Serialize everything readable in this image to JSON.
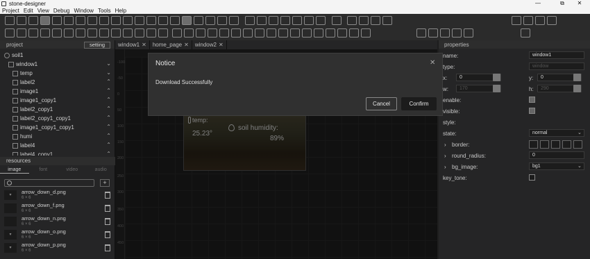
{
  "window": {
    "title": "stone-designer",
    "min": "—",
    "max": "⧉",
    "close": "✕"
  },
  "menu": [
    "Project",
    "Edit",
    "View",
    "Debug",
    "Window",
    "Tools",
    "Help"
  ],
  "left": {
    "project_label": "project",
    "setting_label": "setting",
    "tree": [
      {
        "label": "soil1"
      },
      {
        "label": "window1"
      },
      {
        "label": "temp"
      },
      {
        "label": "label2"
      },
      {
        "label": "image1"
      },
      {
        "label": "image1_copy1"
      },
      {
        "label": "label2_copy1"
      },
      {
        "label": "label2_copy1_copy1"
      },
      {
        "label": "image1_copy1_copy1"
      },
      {
        "label": "humi"
      },
      {
        "label": "label4"
      },
      {
        "label": "label4_copy1"
      }
    ],
    "resources_label": "resources",
    "res_tabs": [
      "image",
      "font",
      "video",
      "audio"
    ],
    "search_placeholder": "",
    "add_label": "+",
    "res_items": [
      {
        "name": "arrow_down_d.png",
        "dim": "6 × 6"
      },
      {
        "name": "arrow_down_f.png",
        "dim": "6 × 6"
      },
      {
        "name": "arrow_down_n.png",
        "dim": "6 × 6"
      },
      {
        "name": "arrow_down_o.png",
        "dim": "6 × 6"
      },
      {
        "name": "arrow_down_p.png",
        "dim": "6 × 6"
      }
    ]
  },
  "tabs": [
    {
      "label": "window1",
      "close": "✕"
    },
    {
      "label": "home_page",
      "close": "✕"
    },
    {
      "label": "window2",
      "close": "✕"
    }
  ],
  "ruler": [
    "-100",
    "-50",
    "0",
    "50",
    "100",
    "150",
    "200",
    "250",
    "300",
    "350",
    "400",
    "450"
  ],
  "device": {
    "temp_label": "temp:",
    "temp_value": "25.23°",
    "humidity_label": "soil humidity:",
    "humidity_value": "89%"
  },
  "properties": {
    "title": "properties",
    "name_key": "name:",
    "name_val": "window1",
    "type_key": "type:",
    "type_val": "window",
    "x_key": "x:",
    "x_val": "0",
    "y_key": "y:",
    "y_val": "0",
    "w_key": "w:",
    "w_val": "170",
    "h_key": "h:",
    "h_val": "290",
    "enable_key": "enable:",
    "visible_key": "visible:",
    "style_key": "style:",
    "state_key": "state:",
    "state_val": "normal",
    "border_key": "border:",
    "radius_key": "round_radius:",
    "radius_val": "0",
    "bg_key": "bg_image:",
    "bg_val": "bg1",
    "keytone_key": "key_tone:"
  },
  "dialog": {
    "title": "Notice",
    "message": "Download Successfully",
    "cancel": "Cancel",
    "confirm": "Confirm",
    "close": "✕"
  }
}
